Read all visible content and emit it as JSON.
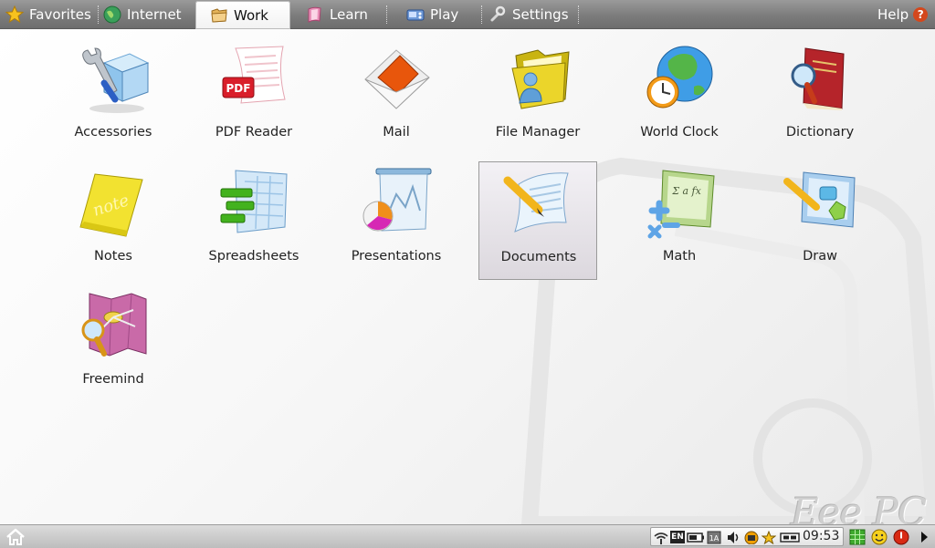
{
  "tabs": [
    {
      "label": "Favorites",
      "icon": "star-icon"
    },
    {
      "label": "Internet",
      "icon": "globe-icon"
    },
    {
      "label": "Work",
      "icon": "folder-icon",
      "active": true
    },
    {
      "label": "Learn",
      "icon": "book-icon"
    },
    {
      "label": "Play",
      "icon": "gamepad-icon"
    },
    {
      "label": "Settings",
      "icon": "wrench-icon"
    }
  ],
  "help": {
    "label": "Help",
    "icon": "question-icon"
  },
  "apps": [
    {
      "label": "Accessories",
      "icon": "accessories-icon"
    },
    {
      "label": "PDF Reader",
      "icon": "pdf-icon",
      "badge": "PDF"
    },
    {
      "label": "Mail",
      "icon": "envelope-icon"
    },
    {
      "label": "File Manager",
      "icon": "folder-user-icon"
    },
    {
      "label": "World Clock",
      "icon": "globe-clock-icon"
    },
    {
      "label": "Dictionary",
      "icon": "dictionary-icon"
    },
    {
      "label": "Notes",
      "icon": "sticky-note-icon",
      "badge": "note"
    },
    {
      "label": "Spreadsheets",
      "icon": "spreadsheet-icon"
    },
    {
      "label": "Presentations",
      "icon": "presentation-icon"
    },
    {
      "label": "Documents",
      "icon": "document-icon",
      "selected": true
    },
    {
      "label": "Math",
      "icon": "math-board-icon",
      "badge": "Σ a fx"
    },
    {
      "label": "Draw",
      "icon": "draw-icon"
    },
    {
      "label": "Freemind",
      "icon": "mindmap-icon"
    }
  ],
  "brand": "Eee PC",
  "taskbar": {
    "clock": "09:53",
    "keyboard_layout": "EN",
    "tray_icons": [
      "wifi-icon",
      "keyboard-layout-icon",
      "battery-icon",
      "display-icon",
      "volume-icon",
      "network-icon",
      "star-status-icon",
      "usb-icon"
    ],
    "right_icons": [
      "desktop-grid-icon",
      "smiley-icon",
      "shutdown-icon",
      "arrow-right-icon"
    ]
  },
  "colors": {
    "tabbar": "#7c7c7c",
    "active_tab": "#ffffff",
    "selection_border": "#9a9a9a",
    "help_badge": "#d4471c"
  }
}
